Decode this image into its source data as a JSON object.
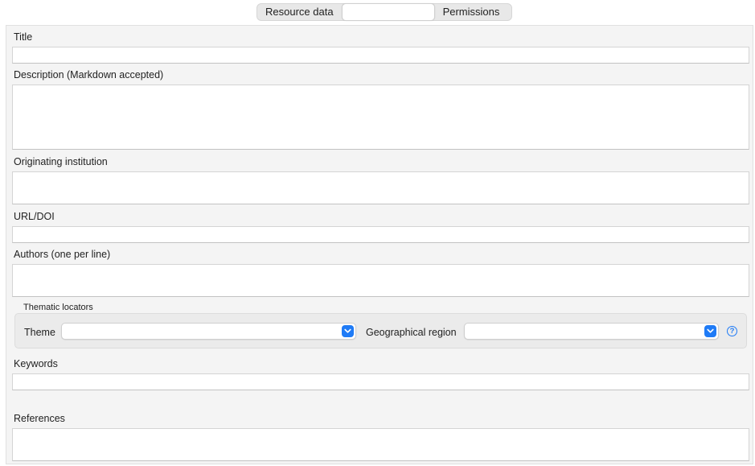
{
  "tabs": [
    {
      "label": "Resource data"
    },
    {
      "label": ""
    },
    {
      "label": "Permissions"
    }
  ],
  "form": {
    "title_label": "Title",
    "title_value": "",
    "description_label": "Description (Markdown accepted)",
    "description_value": "",
    "institution_label": "Originating institution",
    "institution_value": "",
    "url_label": "URL/DOI",
    "url_value": "",
    "authors_label": "Authors (one per line)",
    "authors_value": "",
    "keywords_label": "Keywords",
    "keywords_value": "",
    "references_label": "References",
    "references_value": ""
  },
  "thematic": {
    "group_title": "Thematic locators",
    "theme_label": "Theme",
    "theme_value": "",
    "region_label": "Geographical region",
    "region_value": "",
    "help_icon": "?"
  },
  "colors": {
    "accent": "#1f7bf6",
    "panel_bg": "#f4f4f4",
    "group_bg": "#ebebeb"
  }
}
